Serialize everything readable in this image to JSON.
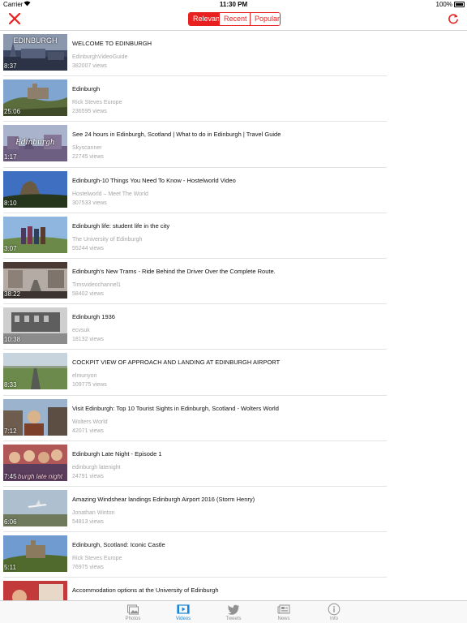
{
  "status_bar": {
    "carrier": "Carrier",
    "time": "11:30 PM",
    "battery": "100%"
  },
  "toolbar": {
    "segments": [
      {
        "label": "Relevant",
        "active": true
      },
      {
        "label": "Recent",
        "active": false
      },
      {
        "label": "Popular",
        "active": false
      }
    ],
    "close_icon": "close-icon",
    "refresh_icon": "refresh-icon",
    "accent_color": "#e8201f"
  },
  "videos": [
    {
      "title": "WELCOME TO EDINBURGH",
      "channel": "EdinburghVideoGuide",
      "views": "382007 views",
      "duration": "8:37",
      "thumb_text": "EDINBURGH"
    },
    {
      "title": "Edinburgh",
      "channel": "Rick Steves Europe",
      "views": "236595 views",
      "duration": "25:06",
      "thumb_text": ""
    },
    {
      "title": "See 24 hours in Edinburgh, Scotland | What to do in Edinburgh | Travel Guide",
      "channel": "Skyscanner",
      "views": "22745 views",
      "duration": "1:17",
      "thumb_text": "Edinburgh"
    },
    {
      "title": "Edinburgh-10 Things You Need To Know - Hostelworld Video",
      "channel": "Hostelworld – Meet The World",
      "views": "307533 views",
      "duration": "8:10",
      "thumb_text": ""
    },
    {
      "title": "Edinburgh life: student life in the city",
      "channel": "The University of Edinburgh",
      "views": "55244 views",
      "duration": "3:07",
      "thumb_text": ""
    },
    {
      "title": "Edinburgh's New Trams - Ride Behind the Driver Over the Complete Route.",
      "channel": "Timsvideochannel1",
      "views": "58402 views",
      "duration": "38:22",
      "thumb_text": ""
    },
    {
      "title": "Edinburgh 1936",
      "channel": "ecvsuk",
      "views": "18132 views",
      "duration": "10:38",
      "thumb_text": ""
    },
    {
      "title": "COCKPIT VIEW OF APPROACH AND LANDING AT EDINBURGH AIRPORT",
      "channel": "elmunyon",
      "views": "109775 views",
      "duration": "8:33",
      "thumb_text": ""
    },
    {
      "title": "Visit Edinburgh: Top 10 Tourist Sights in Edinburgh, Scotland - Wolters World",
      "channel": "Wolters World",
      "views": "42071 views",
      "duration": "7:12",
      "thumb_text": ""
    },
    {
      "title": "Edinburgh Late Night - Episode 1",
      "channel": "edinburgh latenight",
      "views": "24791 views",
      "duration": "7:45",
      "thumb_text": "burgh late night"
    },
    {
      "title": "Amazing Windshear landings Edinburgh Airport 2016  (Storm Henry)",
      "channel": "Jonathan Winton",
      "views": "54813 views",
      "duration": "6:06",
      "thumb_text": ""
    },
    {
      "title": "Edinburgh, Scotland: Iconic Castle",
      "channel": "Rick Steves Europe",
      "views": "76975 views",
      "duration": "5:11",
      "thumb_text": ""
    },
    {
      "title": "Accommodation options at the University of Edinburgh",
      "channel": "",
      "views": "",
      "duration": "",
      "thumb_text": ""
    }
  ],
  "tabs": [
    {
      "label": "Photos",
      "icon": "photos-icon",
      "active": false
    },
    {
      "label": "Videos",
      "icon": "videos-icon",
      "active": true
    },
    {
      "label": "Tweets",
      "icon": "twitter-bird-icon",
      "active": false
    },
    {
      "label": "News",
      "icon": "newspaper-icon",
      "active": false
    },
    {
      "label": "Info",
      "icon": "info-icon",
      "active": false
    }
  ]
}
